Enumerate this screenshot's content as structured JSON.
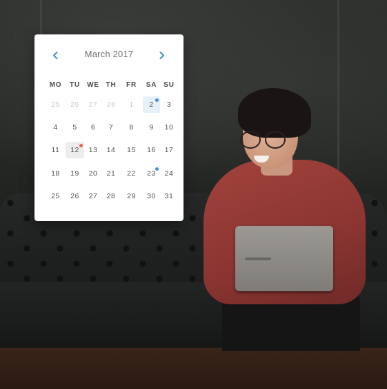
{
  "calendar": {
    "month_label": "March 2017",
    "prev_icon": "chevron-left-icon",
    "next_icon": "chevron-right-icon",
    "accent_color": "#3b8fe3",
    "weekdays": [
      "MO",
      "TU",
      "WE",
      "TH",
      "FR",
      "SA",
      "SU"
    ],
    "weeks": [
      [
        {
          "d": "25",
          "muted": true
        },
        {
          "d": "26",
          "muted": true
        },
        {
          "d": "27",
          "muted": true
        },
        {
          "d": "28",
          "muted": true
        },
        {
          "d": "1",
          "muted": true
        },
        {
          "d": "2",
          "selected": true,
          "dot": "#3b8fe3"
        },
        {
          "d": "3"
        }
      ],
      [
        {
          "d": "4"
        },
        {
          "d": "5"
        },
        {
          "d": "6"
        },
        {
          "d": "7"
        },
        {
          "d": "8"
        },
        {
          "d": "9"
        },
        {
          "d": "10"
        }
      ],
      [
        {
          "d": "11"
        },
        {
          "d": "12",
          "highlight": true,
          "dot": "#e8664a"
        },
        {
          "d": "13"
        },
        {
          "d": "14"
        },
        {
          "d": "15"
        },
        {
          "d": "16"
        },
        {
          "d": "17"
        }
      ],
      [
        {
          "d": "18"
        },
        {
          "d": "19"
        },
        {
          "d": "20"
        },
        {
          "d": "21"
        },
        {
          "d": "22"
        },
        {
          "d": "23",
          "dot": "#3b8fe3"
        },
        {
          "d": "24"
        }
      ],
      [
        {
          "d": "25"
        },
        {
          "d": "26"
        },
        {
          "d": "27"
        },
        {
          "d": "28"
        },
        {
          "d": "29"
        },
        {
          "d": "30"
        },
        {
          "d": "31"
        }
      ]
    ]
  }
}
